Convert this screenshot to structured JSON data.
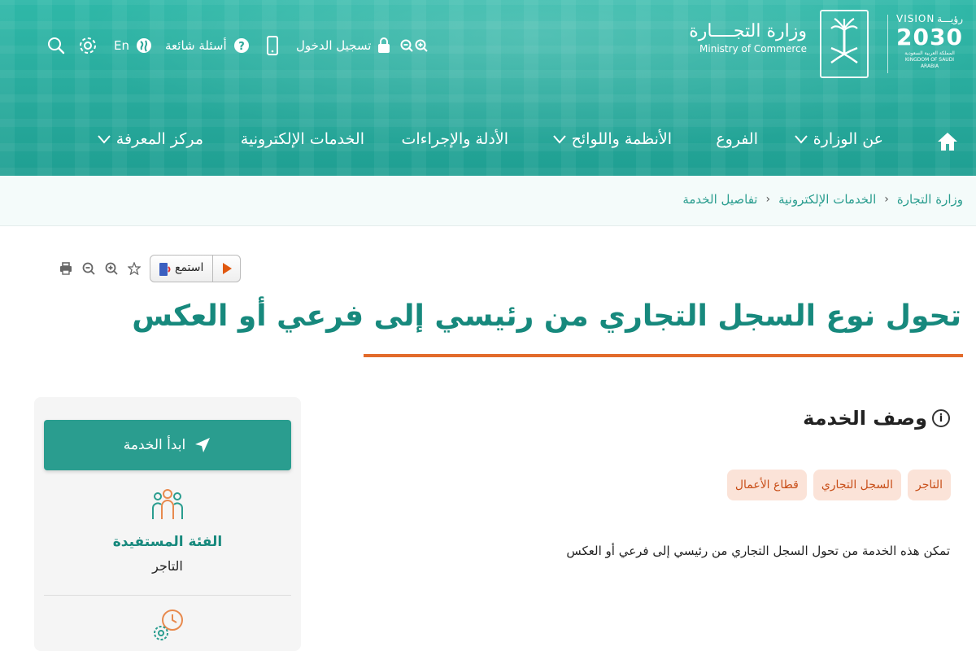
{
  "header": {
    "topbar": {
      "search_icon": "search-icon",
      "settings_icon": "gear-icon",
      "language_label": "En",
      "faq_label": "أسئلة شائعة",
      "login_label": "تسجيل الدخول",
      "zoom_in_icon": "zoom-in-icon",
      "zoom_out_icon": "zoom-out-icon"
    },
    "ministry": {
      "name_ar": "وزارة التجــــارة",
      "name_en": "Ministry of Commerce"
    },
    "vision": {
      "top_en": "VISION",
      "top_ar": "رؤيـــة",
      "year": "2030",
      "sub_ar": "المملكة العربية السعودية",
      "sub_en": "KINGDOM OF SAUDI ARABIA"
    },
    "nav": {
      "home_icon": "home-icon",
      "items": [
        "عن الوزارة",
        "الفروع",
        "الأنظمة واللوائح",
        "الأدلة والإجراءات",
        "الخدمات الإلكترونية",
        "مركز المعرفة"
      ]
    }
  },
  "breadcrumb": [
    "وزارة التجارة",
    "الخدمات الإلكترونية",
    "تفاصيل الخدمة"
  ],
  "toolbar": {
    "listen_label": "استمع"
  },
  "page": {
    "title": "تحول نوع السجل التجاري من رئيسي إلى فرعي أو العكس",
    "section_title": "وصف الخدمة",
    "info_glyph": "i",
    "tags": [
      "التاجر",
      "السجل التجاري",
      "قطاع الأعمال"
    ],
    "description": "تمكن هذه الخدمة من تحول السجل التجاري من رئيسي إلى  فرعي أو العكس"
  },
  "sidebar": {
    "start_label": "ابدأ الخدمة",
    "beneficiary_title": "الفئة المستفيدة",
    "beneficiary_value": "التاجر"
  },
  "colors": {
    "primary": "#2a9d8f",
    "title": "#17897d",
    "accent": "#e26b2b",
    "tag_bg": "#fbe3d8",
    "tag_text": "#c84e18"
  }
}
